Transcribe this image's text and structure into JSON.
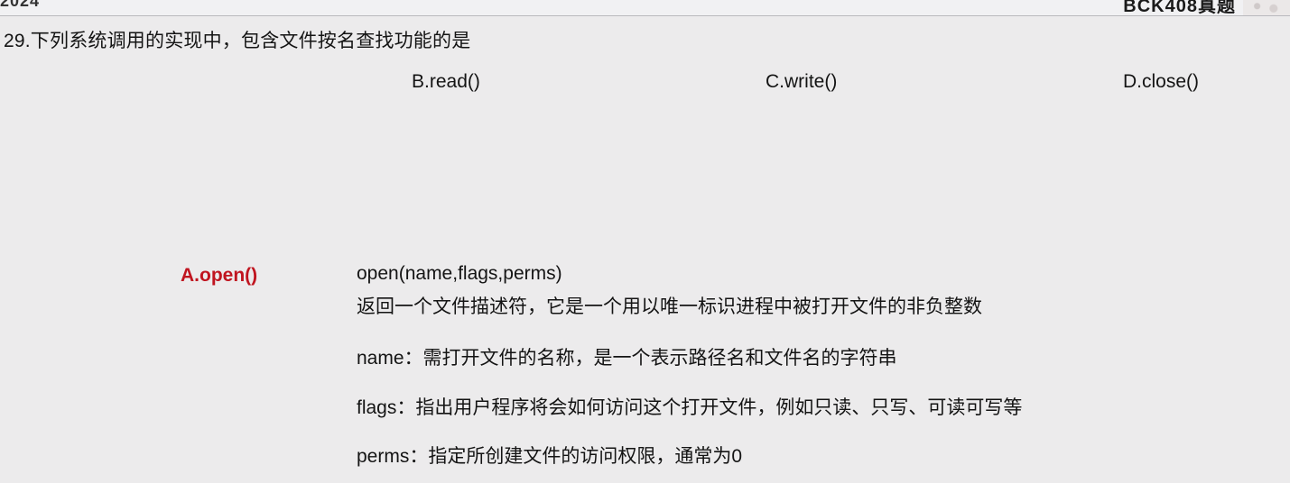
{
  "header": {
    "left_cut_text": "2024",
    "right_cut_text": "BCK408真题"
  },
  "question": {
    "text": "29.下列系统调用的实现中，包含文件按名查找功能的是",
    "choices": {
      "b": "B.read()",
      "c": "C.write()",
      "d": "D.close()"
    },
    "answer": "A.open()"
  },
  "explanation": {
    "signature": "open(name,flags,perms)",
    "returns": "返回一个文件描述符，它是一个用以唯一标识进程中被打开文件的非负整数",
    "name_desc": "name：需打开文件的名称，是一个表示路径名和文件名的字符串",
    "flags_desc": "flags：指出用户程序将会如何访问这个打开文件，例如只读、只写、可读可写等",
    "perms_desc": "perms：指定所创建文件的访问权限，通常为0"
  },
  "colors": {
    "answer": "#c0141f",
    "background": "#ecebec"
  }
}
